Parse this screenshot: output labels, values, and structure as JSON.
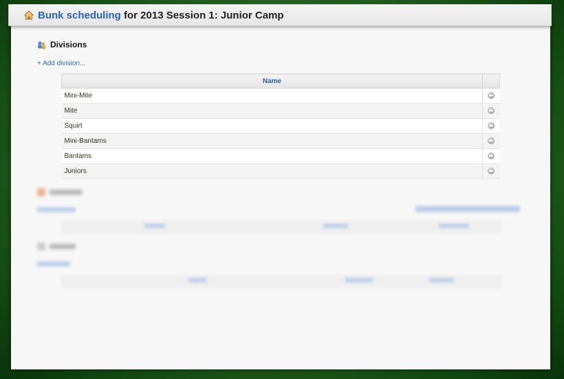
{
  "header": {
    "app_link": "Bunk scheduling",
    "title_rest": " for 2013 Session 1: Junior Camp"
  },
  "divisions": {
    "heading": "Divisions",
    "add_link": "+ Add division...",
    "column_name": "Name",
    "rows": [
      "Mini-Mite",
      "Mite",
      "Squirt",
      "Mini-Bantams",
      "Bantams",
      "Juniors"
    ]
  },
  "colors": {
    "link": "#2a62b8",
    "background_green": "#2a6b24",
    "header_text": "#2f5f9f"
  }
}
